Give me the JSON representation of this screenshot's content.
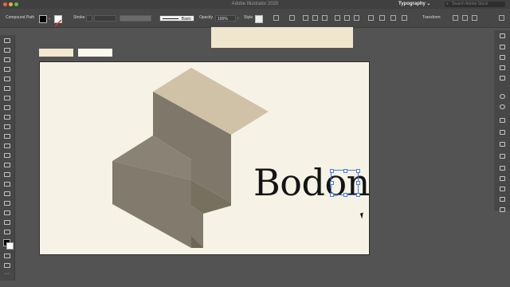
{
  "app": {
    "title": "Adobe Illustrator 2020",
    "workspace": "Typography",
    "search_placeholder": "Search Adobe Stock"
  },
  "control_bar": {
    "selection_type": "Compound Path",
    "stroke_label": "Stroke",
    "brush_label": "Basic",
    "opacity_label": "Opacity",
    "opacity_value": "100%",
    "style_label": "Style",
    "transform_label": "Transform"
  },
  "canvas": {
    "text_object": "Bodoni",
    "colors": {
      "artboard": "#f6f3e6",
      "top_artboard": "#efe6cd",
      "swatch_a": "#f2e7cf",
      "swatch_b": "#fbf8ec",
      "shape_top": "#cfc2a6",
      "shape_side": "#7f776a",
      "shape_front": "#8f877a",
      "selection": "#4a7bd8"
    }
  },
  "icons": {
    "toolbar": [
      "selection-icon",
      "direct-selection-icon",
      "pen-icon",
      "curvature-icon",
      "rectangle-icon",
      "brush-icon",
      "type-icon",
      "line-icon",
      "eraser-icon",
      "rotate-icon",
      "scale-icon",
      "width-icon",
      "shape-builder-icon",
      "eyedropper-icon",
      "blend-icon",
      "symbol-sprayer-icon",
      "graph-icon",
      "artboard-icon",
      "slice-icon",
      "hand-icon",
      "zoom-icon",
      "fill-stroke-icon",
      "draw-mode-icon",
      "screen-mode-icon",
      "more-tools-icon"
    ],
    "dock": [
      "properties-icon",
      "paragraph-icon",
      "glyphs-icon",
      "opentype-icon",
      "character-icon",
      "color-icon",
      "appearance-icon",
      "stroke-icon",
      "gradient-icon",
      "layers-icon",
      "libraries-icon",
      "asset-export-icon",
      "artboards-icon",
      "align-icon",
      "pathfinder-icon",
      "symbols-icon",
      "brushes-icon"
    ]
  }
}
